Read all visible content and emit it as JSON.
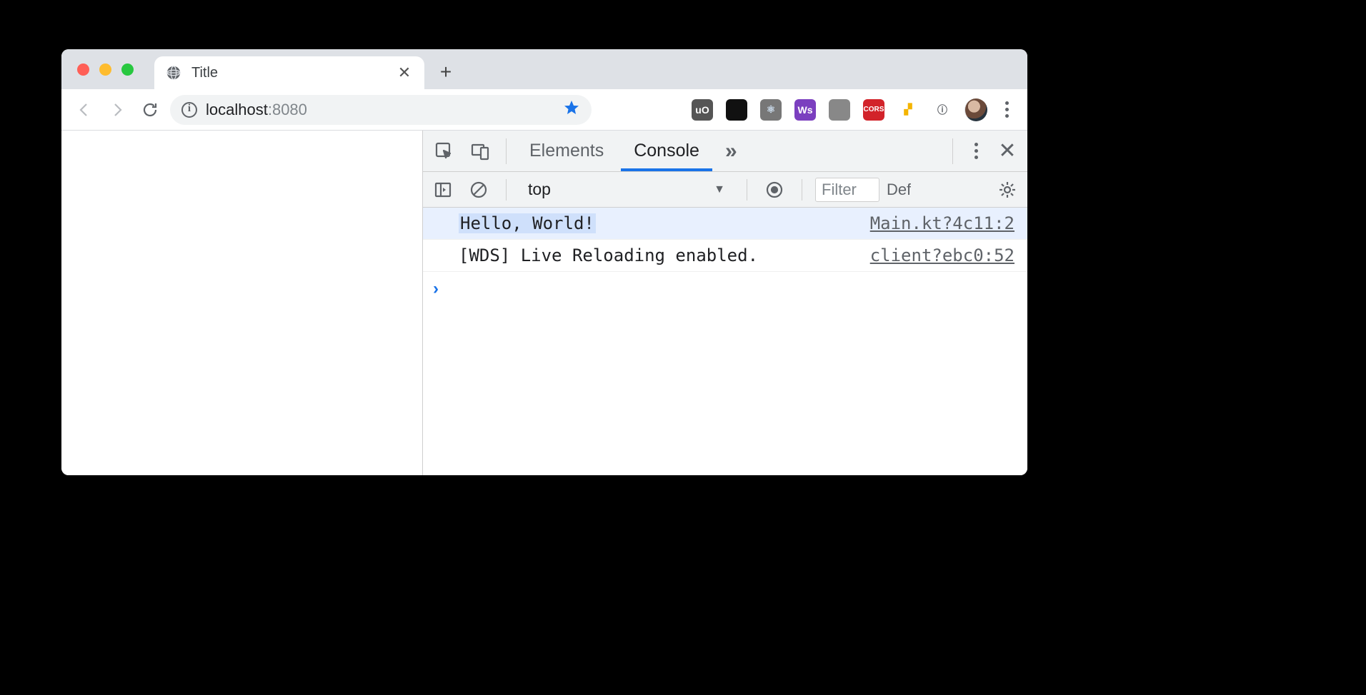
{
  "tab": {
    "title": "Title"
  },
  "address": {
    "host": "localhost",
    "port": ":8080"
  },
  "extensions": [
    {
      "name": "ublock",
      "label": "uO",
      "bg": "#555",
      "fg": "#fff"
    },
    {
      "name": "apollo",
      "label": "",
      "bg": "#111",
      "fg": "#8ad"
    },
    {
      "name": "react",
      "label": "⚛",
      "bg": "#777",
      "fg": "#cde"
    },
    {
      "name": "webstorm",
      "label": "Ws",
      "bg": "#7b3fbf",
      "fg": "#fff"
    },
    {
      "name": "mouse",
      "label": "",
      "bg": "#888",
      "fg": "#222"
    },
    {
      "name": "cors",
      "label": "CORS",
      "bg": "#d2232a",
      "fg": "#fff"
    },
    {
      "name": "lighthouse",
      "label": "▞",
      "bg": "#fff",
      "fg": "#f4b400"
    },
    {
      "name": "info",
      "label": "ⓘ",
      "bg": "transparent",
      "fg": "#5f6368"
    }
  ],
  "devtools": {
    "tabs": {
      "elements": "Elements",
      "console": "Console",
      "more": "»"
    },
    "context": "top",
    "filter_placeholder": "Filter",
    "levels_label": "Default levels",
    "messages": [
      {
        "text": "Hello, World!",
        "source": "Main.kt?4c11:2",
        "highlighted": true
      },
      {
        "text": "[WDS] Live Reloading enabled.",
        "source": "client?ebc0:52",
        "highlighted": false
      }
    ]
  }
}
